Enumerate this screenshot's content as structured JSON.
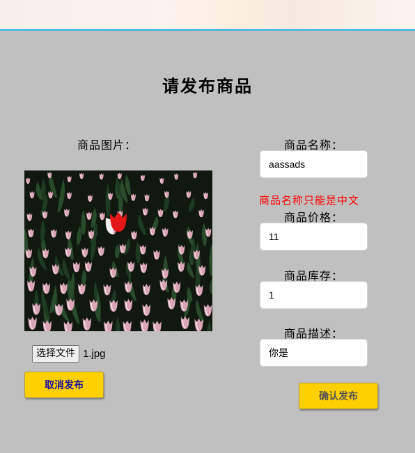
{
  "page": {
    "title": "请发布商品"
  },
  "image_section": {
    "label": "商品图片：",
    "file_button_label": "选择文件",
    "file_name": "1.jpg"
  },
  "fields": {
    "name": {
      "label": "商品名称：",
      "value": "aassads",
      "error": "商品名称只能是中文"
    },
    "price": {
      "label": "商品价格：",
      "value": "11"
    },
    "stock": {
      "label": "商品库存：",
      "value": "1"
    },
    "description": {
      "label": "商品描述：",
      "value": "你是"
    }
  },
  "buttons": {
    "cancel_label": "取消发布",
    "confirm_label": "确认发布"
  },
  "colors": {
    "background": "#c0c0c0",
    "button": "#ffd000",
    "error": "#ff0000",
    "banner_border": "#35b3e6"
  }
}
